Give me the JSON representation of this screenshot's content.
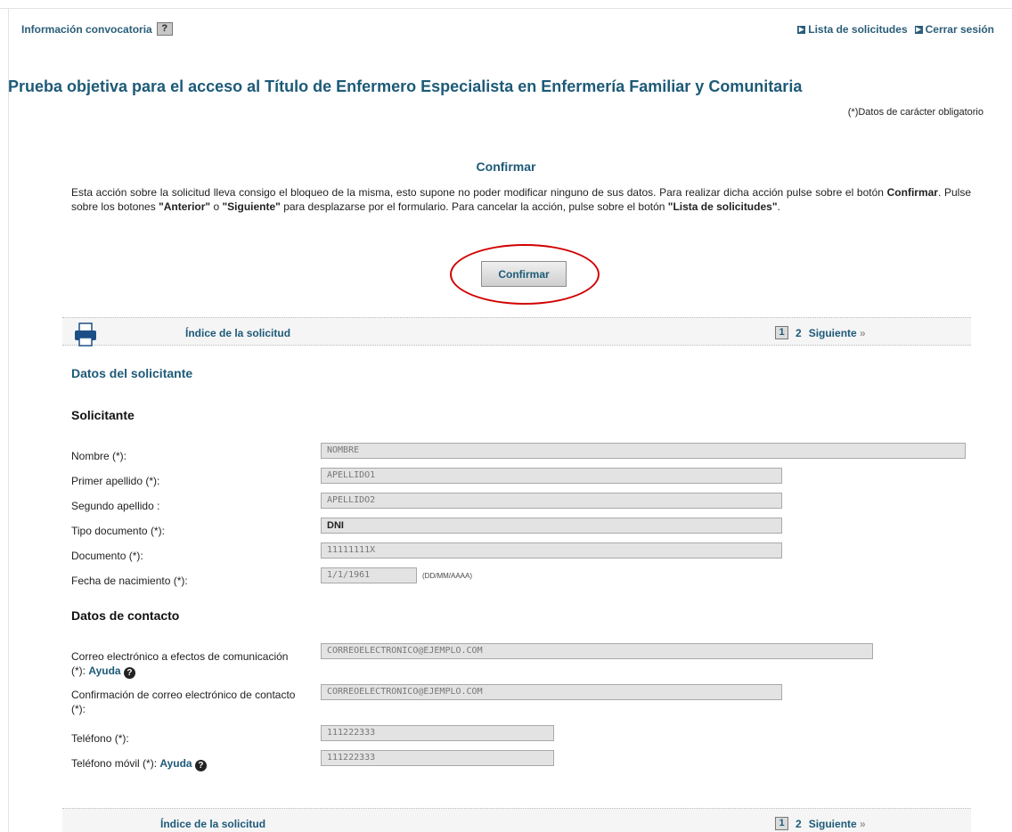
{
  "topbar": {
    "info_label": "Información convocatoria",
    "help_icon": "?",
    "links": [
      "Lista de solicitudes",
      "Cerrar sesión"
    ]
  },
  "title": "Prueba objetiva para el acceso al Título de Enfermero Especialista en Enfermería Familiar y Comunitaria",
  "mandatory_note": "(*)Datos de carácter obligatorio",
  "confirm": {
    "heading": "Confirmar",
    "text_1": "Esta acción sobre la solicitud lleva consigo el bloqueo de la misma, esto supone no poder modificar ninguno de sus datos. Para realizar dicha acción pulse sobre el botón ",
    "text_b1": "Confirmar",
    "text_2": ". Pulse sobre los botones ",
    "text_b2": "\"Anterior\"",
    "text_3": " o ",
    "text_b3": "\"Siguiente\"",
    "text_4": " para desplazarse por el formulario. Para cancelar la acción, pulse sobre el botón ",
    "text_b4": "\"Lista de solicitudes\"",
    "text_5": ".",
    "button_label": "Confirmar"
  },
  "nav": {
    "index_label": "Índice de la solicitud",
    "pages": [
      "1",
      "2"
    ],
    "current_page": "1",
    "next_label": "Siguiente",
    "next_icon": "»"
  },
  "section_title": "Datos del solicitante",
  "applicant": {
    "heading": "Solicitante",
    "fields": [
      {
        "label": "Nombre (*):",
        "value": "NOMBRE"
      },
      {
        "label": "Primer apellido (*):",
        "value": "APELLIDO1"
      },
      {
        "label": "Segundo apellido :",
        "value": "APELLIDO2"
      },
      {
        "label": "Tipo documento (*):",
        "value": "DNI"
      },
      {
        "label": "Documento (*):",
        "value": "11111111X"
      },
      {
        "label": "Fecha de nacimiento (*):",
        "value": "1/1/1961",
        "format_hint": "(DD/MM/AAAA)"
      }
    ]
  },
  "contact": {
    "heading": "Datos de contacto",
    "help_label": "Ayuda",
    "fields": [
      {
        "label": "Correo electrónico a efectos de comunicación",
        "label_2": "(*): ",
        "value": "CORREOELECTRONICO@EJEMPLO.COM"
      },
      {
        "label": "Confirmación de correo electrónico de contacto",
        "label_2": "(*):",
        "value": "CORREOELECTRONICO@EJEMPLO.COM"
      },
      {
        "label": "Teléfono (*):",
        "value": "111222333"
      },
      {
        "label": "Teléfono móvil (*): ",
        "value": "111222333"
      }
    ]
  }
}
